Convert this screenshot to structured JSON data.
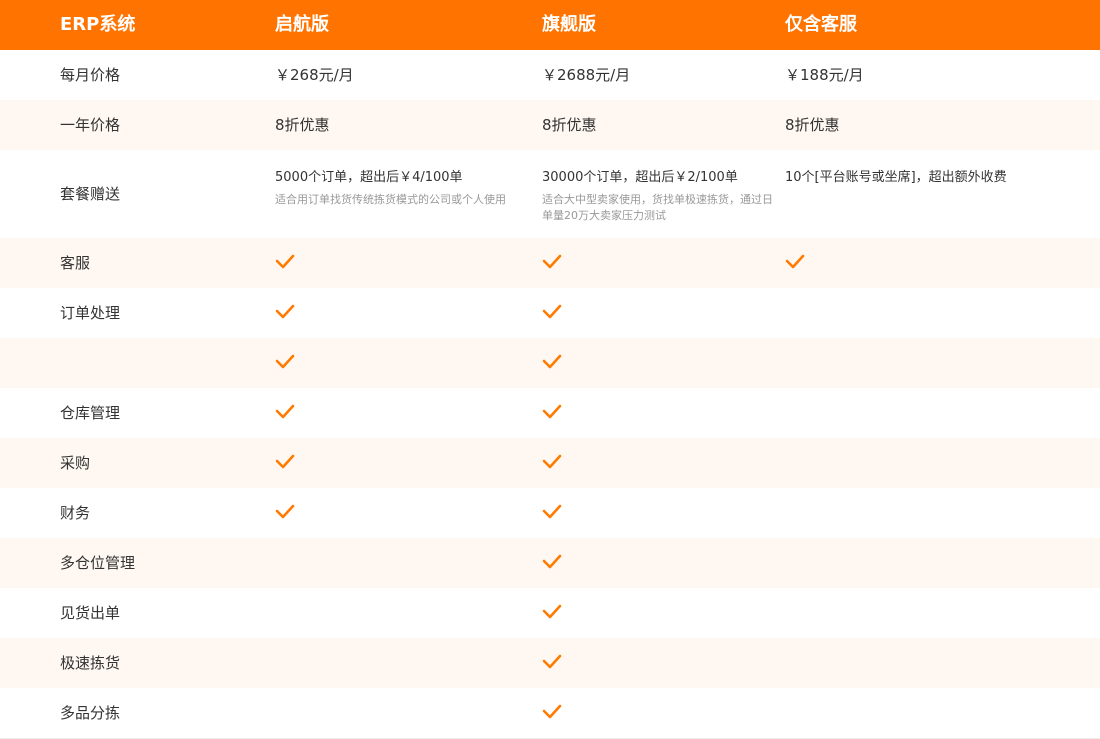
{
  "header": {
    "col0": "ERP系统",
    "col1": "启航版",
    "col2": "旗舰版",
    "col3": "仅含客服"
  },
  "colors": {
    "accent": "#ff7300",
    "row_alt": "#fff8f2",
    "check": "#ff7a00"
  },
  "rows": [
    {
      "label": "每月价格",
      "values": [
        "￥268元/月",
        "￥2688元/月",
        "￥188元/月"
      ]
    },
    {
      "label": "一年价格",
      "values": [
        "8折优惠",
        "8折优惠",
        "8折优惠"
      ]
    },
    {
      "label": "套餐赠送",
      "plans": [
        {
          "main": "5000个订单，超出后￥4/100单",
          "sub": "适合用订单找货传统拣货模式的公司或个人使用"
        },
        {
          "main": "30000个订单，超出后￥2/100单",
          "sub": "适合大中型卖家使用，货找单极速拣货，通过日单量20万大卖家压力测试"
        },
        {
          "main": "10个[平台账号或坐席]，超出额外收费",
          "sub": ""
        }
      ]
    },
    {
      "label": "客服",
      "checks": [
        true,
        true,
        true
      ]
    },
    {
      "label": "订单处理",
      "checks": [
        true,
        true,
        false
      ]
    },
    {
      "label": "",
      "checks": [
        true,
        true,
        false
      ]
    },
    {
      "label": "仓库管理",
      "checks": [
        true,
        true,
        false
      ]
    },
    {
      "label": "采购",
      "checks": [
        true,
        true,
        false
      ]
    },
    {
      "label": "财务",
      "checks": [
        true,
        true,
        false
      ]
    },
    {
      "label": "多仓位管理",
      "checks": [
        false,
        true,
        false
      ]
    },
    {
      "label": "见货出单",
      "checks": [
        false,
        true,
        false
      ]
    },
    {
      "label": "极速拣货",
      "checks": [
        false,
        true,
        false
      ]
    },
    {
      "label": "多品分拣",
      "checks": [
        false,
        true,
        false
      ]
    }
  ],
  "icons": {
    "check": "check-icon"
  }
}
